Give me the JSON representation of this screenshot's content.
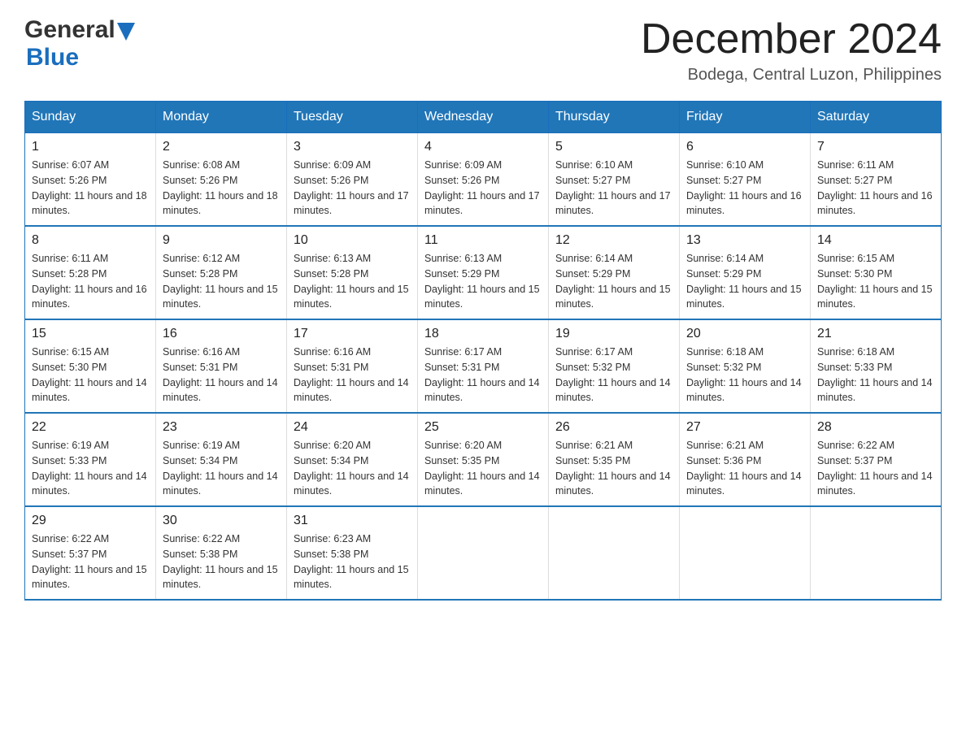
{
  "header": {
    "logo_text_general": "General",
    "logo_text_blue": "Blue",
    "month_title": "December 2024",
    "location": "Bodega, Central Luzon, Philippines"
  },
  "days_of_week": [
    "Sunday",
    "Monday",
    "Tuesday",
    "Wednesday",
    "Thursday",
    "Friday",
    "Saturday"
  ],
  "weeks": [
    [
      {
        "day": "1",
        "sunrise": "6:07 AM",
        "sunset": "5:26 PM",
        "daylight": "11 hours and 18 minutes."
      },
      {
        "day": "2",
        "sunrise": "6:08 AM",
        "sunset": "5:26 PM",
        "daylight": "11 hours and 18 minutes."
      },
      {
        "day": "3",
        "sunrise": "6:09 AM",
        "sunset": "5:26 PM",
        "daylight": "11 hours and 17 minutes."
      },
      {
        "day": "4",
        "sunrise": "6:09 AM",
        "sunset": "5:26 PM",
        "daylight": "11 hours and 17 minutes."
      },
      {
        "day": "5",
        "sunrise": "6:10 AM",
        "sunset": "5:27 PM",
        "daylight": "11 hours and 17 minutes."
      },
      {
        "day": "6",
        "sunrise": "6:10 AM",
        "sunset": "5:27 PM",
        "daylight": "11 hours and 16 minutes."
      },
      {
        "day": "7",
        "sunrise": "6:11 AM",
        "sunset": "5:27 PM",
        "daylight": "11 hours and 16 minutes."
      }
    ],
    [
      {
        "day": "8",
        "sunrise": "6:11 AM",
        "sunset": "5:28 PM",
        "daylight": "11 hours and 16 minutes."
      },
      {
        "day": "9",
        "sunrise": "6:12 AM",
        "sunset": "5:28 PM",
        "daylight": "11 hours and 15 minutes."
      },
      {
        "day": "10",
        "sunrise": "6:13 AM",
        "sunset": "5:28 PM",
        "daylight": "11 hours and 15 minutes."
      },
      {
        "day": "11",
        "sunrise": "6:13 AM",
        "sunset": "5:29 PM",
        "daylight": "11 hours and 15 minutes."
      },
      {
        "day": "12",
        "sunrise": "6:14 AM",
        "sunset": "5:29 PM",
        "daylight": "11 hours and 15 minutes."
      },
      {
        "day": "13",
        "sunrise": "6:14 AM",
        "sunset": "5:29 PM",
        "daylight": "11 hours and 15 minutes."
      },
      {
        "day": "14",
        "sunrise": "6:15 AM",
        "sunset": "5:30 PM",
        "daylight": "11 hours and 15 minutes."
      }
    ],
    [
      {
        "day": "15",
        "sunrise": "6:15 AM",
        "sunset": "5:30 PM",
        "daylight": "11 hours and 14 minutes."
      },
      {
        "day": "16",
        "sunrise": "6:16 AM",
        "sunset": "5:31 PM",
        "daylight": "11 hours and 14 minutes."
      },
      {
        "day": "17",
        "sunrise": "6:16 AM",
        "sunset": "5:31 PM",
        "daylight": "11 hours and 14 minutes."
      },
      {
        "day": "18",
        "sunrise": "6:17 AM",
        "sunset": "5:31 PM",
        "daylight": "11 hours and 14 minutes."
      },
      {
        "day": "19",
        "sunrise": "6:17 AM",
        "sunset": "5:32 PM",
        "daylight": "11 hours and 14 minutes."
      },
      {
        "day": "20",
        "sunrise": "6:18 AM",
        "sunset": "5:32 PM",
        "daylight": "11 hours and 14 minutes."
      },
      {
        "day": "21",
        "sunrise": "6:18 AM",
        "sunset": "5:33 PM",
        "daylight": "11 hours and 14 minutes."
      }
    ],
    [
      {
        "day": "22",
        "sunrise": "6:19 AM",
        "sunset": "5:33 PM",
        "daylight": "11 hours and 14 minutes."
      },
      {
        "day": "23",
        "sunrise": "6:19 AM",
        "sunset": "5:34 PM",
        "daylight": "11 hours and 14 minutes."
      },
      {
        "day": "24",
        "sunrise": "6:20 AM",
        "sunset": "5:34 PM",
        "daylight": "11 hours and 14 minutes."
      },
      {
        "day": "25",
        "sunrise": "6:20 AM",
        "sunset": "5:35 PM",
        "daylight": "11 hours and 14 minutes."
      },
      {
        "day": "26",
        "sunrise": "6:21 AM",
        "sunset": "5:35 PM",
        "daylight": "11 hours and 14 minutes."
      },
      {
        "day": "27",
        "sunrise": "6:21 AM",
        "sunset": "5:36 PM",
        "daylight": "11 hours and 14 minutes."
      },
      {
        "day": "28",
        "sunrise": "6:22 AM",
        "sunset": "5:37 PM",
        "daylight": "11 hours and 14 minutes."
      }
    ],
    [
      {
        "day": "29",
        "sunrise": "6:22 AM",
        "sunset": "5:37 PM",
        "daylight": "11 hours and 15 minutes."
      },
      {
        "day": "30",
        "sunrise": "6:22 AM",
        "sunset": "5:38 PM",
        "daylight": "11 hours and 15 minutes."
      },
      {
        "day": "31",
        "sunrise": "6:23 AM",
        "sunset": "5:38 PM",
        "daylight": "11 hours and 15 minutes."
      },
      {
        "day": "",
        "sunrise": "",
        "sunset": "",
        "daylight": ""
      },
      {
        "day": "",
        "sunrise": "",
        "sunset": "",
        "daylight": ""
      },
      {
        "day": "",
        "sunrise": "",
        "sunset": "",
        "daylight": ""
      },
      {
        "day": "",
        "sunrise": "",
        "sunset": "",
        "daylight": ""
      }
    ]
  ],
  "labels": {
    "sunrise_prefix": "Sunrise: ",
    "sunset_prefix": "Sunset: ",
    "daylight_prefix": "Daylight: "
  }
}
